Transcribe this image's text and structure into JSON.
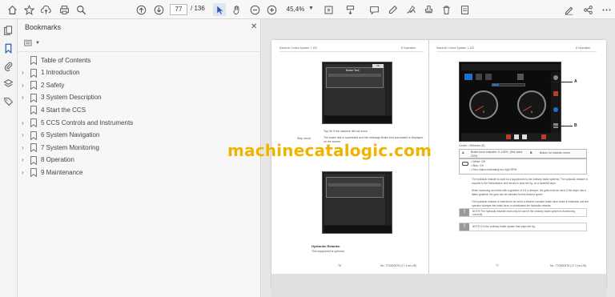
{
  "toolbar": {
    "page_current": "77",
    "page_total": "/ 136",
    "zoom": "45,4%",
    "icons": [
      "home-icon",
      "bookmark-star-icon",
      "cloud-upload-icon",
      "print-icon",
      "search-icon",
      "page-up-icon",
      "page-down-icon",
      "select-cursor-icon",
      "hand-pan-icon",
      "zoom-out-icon",
      "zoom-in-icon",
      "fit-page-icon",
      "scroll-mode-icon",
      "comment-icon",
      "highlight-pen-icon",
      "sign-pen-icon",
      "delete-icon",
      "stamp-icon",
      "sign-icon",
      "share-icon",
      "more-icon"
    ]
  },
  "rail": {
    "icons": [
      "pages-icon",
      "bookmarks-icon",
      "attachments-icon",
      "layers-icon",
      "tags-icon"
    ]
  },
  "bookmarks": {
    "title": "Bookmarks",
    "close": "✕",
    "items": [
      {
        "label": "Table of Contents",
        "expandable": false
      },
      {
        "label": "1 Introduction",
        "expandable": true
      },
      {
        "label": "2 Safety",
        "expandable": true
      },
      {
        "label": "3 System Description",
        "expandable": true
      },
      {
        "label": "4 Start the CCS",
        "expandable": false
      },
      {
        "label": "5 CCS Controls and Instruments",
        "expandable": true
      },
      {
        "label": "6 System Navigation",
        "expandable": true
      },
      {
        "label": "7 System Monitoring",
        "expandable": true
      },
      {
        "label": "8 Operation",
        "expandable": true
      },
      {
        "label": "9 Maintenance",
        "expandable": true
      }
    ]
  },
  "document": {
    "left_page": {
      "header_left": "Sandvik Control System 1.132",
      "header_right": "8 Operation",
      "dialog_title": "Brake Test",
      "side_label": "Step result",
      "step_text_1": "Tap Ok if the machine did not move.",
      "step_text_2": "The brake test is successful and the message Brake test successful is displayed on the screen.",
      "section_title": "Hydraulic Retarder",
      "section_text": "This equipment is optional.",
      "footer_page": "76",
      "footer_doc": "No. TT0000479 (17.1 en-US)"
    },
    "right_page": {
      "header_left": "Sandvik Control System 1.132",
      "header_right": "8 Operation",
      "figure_caption": "Center • Retarder (8)",
      "callouts": [
        "A",
        "B"
      ],
      "table_row_a_label": "A",
      "table_row_a_text": "Brake force indicator. 0–100%. (Std value 20%)",
      "table_row_b_label": "B",
      "table_row_b_text": "Button for retarder menu.",
      "legend_1": "• White: Off",
      "legend_2": "• Blue: On",
      "legend_3": "• Red: Alarm indicating too high RPM",
      "body_1": "The hydraulic retarder is used as a supplement to the ordinary brake systems. The hydraulic retarder is coupled to the transmission and serves to slow the rig, on a downhill slope.",
      "body_2": "When traversing an incline with a gradient of 1:8 or steeper, the gear must be used. If the slope has a flatter gradient, the gear can be selected for this desired speed.",
      "body_3": "The hydraulic retarder is intended to be set to a desired constant brake force which it maintains until the operator changes the brake force or deactivates the hydraulic retarder.",
      "note_1": "NOTE! The hydraulic retarder must only be used if the ordinary brake system is functioning correctly.",
      "note_2": "NOTE! It is the ordinary brake system that stops the rig.",
      "gauge_left_value": "0",
      "gauge_right_value": "0",
      "footer_page": "77",
      "footer_doc": "No. TT0000479 (17.1 en-US)"
    }
  },
  "watermark": "machinecatalogic.com",
  "colors": {
    "watermark": "#f0b400",
    "toolbar_bg": "#f7f7f7",
    "panel_bg": "#f7f7f7",
    "viewport_bg": "#e6e6e6"
  }
}
